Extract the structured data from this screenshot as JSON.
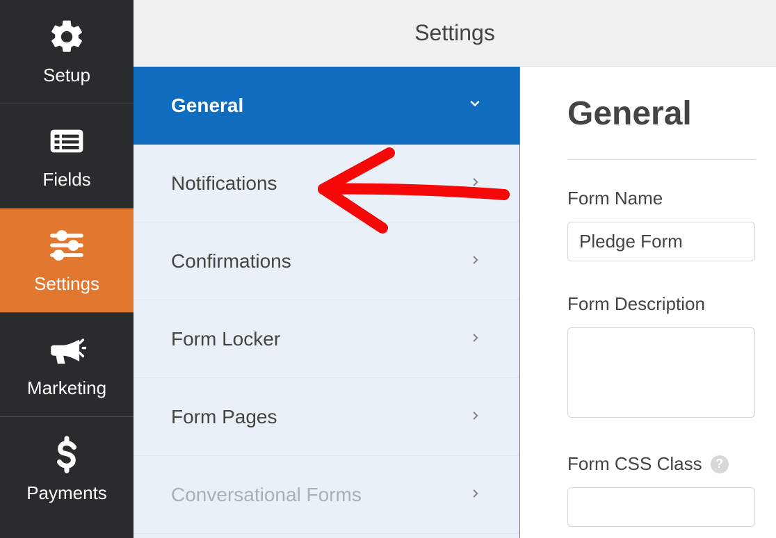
{
  "header": {
    "title": "Settings"
  },
  "iconbar": {
    "items": [
      {
        "label": "Setup"
      },
      {
        "label": "Fields"
      },
      {
        "label": "Settings"
      },
      {
        "label": "Marketing"
      },
      {
        "label": "Payments"
      }
    ]
  },
  "settingsList": {
    "items": [
      {
        "label": "General"
      },
      {
        "label": "Notifications"
      },
      {
        "label": "Confirmations"
      },
      {
        "label": "Form Locker"
      },
      {
        "label": "Form Pages"
      },
      {
        "label": "Conversational Forms"
      }
    ]
  },
  "panel": {
    "heading": "General",
    "formNameLabel": "Form Name",
    "formNameValue": "Pledge Form",
    "formDescriptionLabel": "Form Description",
    "formDescriptionValue": "",
    "formCssClassLabel": "Form CSS Class"
  }
}
